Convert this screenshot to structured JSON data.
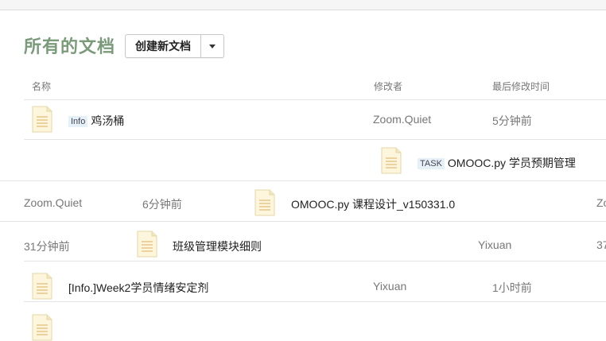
{
  "top_bar": {
    "glyph": "ʼ"
  },
  "page": {
    "title": "所有的文档",
    "create_button": "创建新文档"
  },
  "columns": {
    "name": "名称",
    "modifier": "修改者",
    "modified_time": "最后修改时间"
  },
  "rows": [
    {
      "tag": "Info",
      "title": "鸡汤桶",
      "modifier": "Zoom.Quiet",
      "time": "5分钟前"
    },
    {
      "tag": "TASK",
      "title": "OMOOC.py 学员预期管理",
      "modifier": "Zoom.Quiet",
      "time": "6分钟前"
    },
    {
      "tag": "",
      "title": "OMOOC.py 课程设计_v150331.0",
      "modifier": "Zo",
      "time": "31分钟前"
    },
    {
      "tag": "",
      "title": "班级管理模块细则",
      "modifier": "Yixuan",
      "time": "37"
    },
    {
      "tag": "",
      "title": "[Info.]Week2学员情绪安定剂",
      "modifier": "Yixuan",
      "time": "1小时前"
    }
  ]
}
